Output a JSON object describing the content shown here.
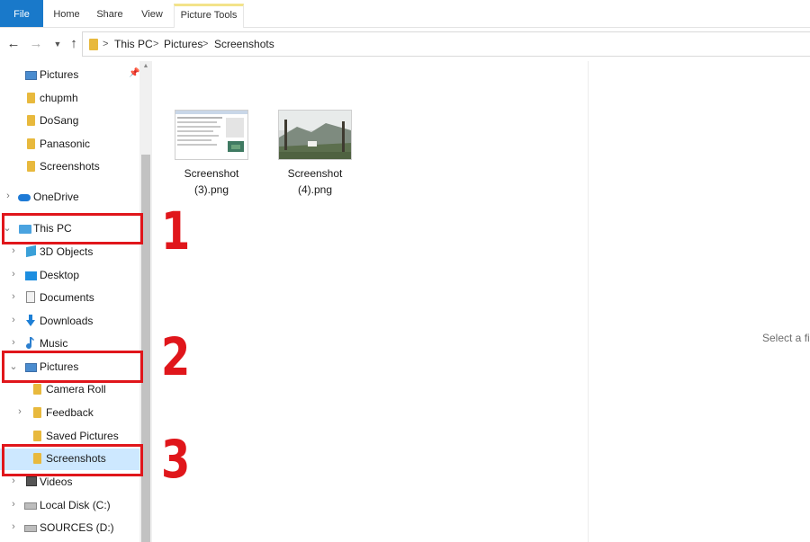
{
  "ribbon": {
    "tabs": [
      "File",
      "Home",
      "Share",
      "View",
      "Picture Tools"
    ]
  },
  "address": {
    "crumbs": [
      "This PC",
      "Pictures",
      "Screenshots"
    ],
    "separator": ">"
  },
  "nav": {
    "quick_access": [
      {
        "label": "Pictures",
        "icon": "pictures-icon",
        "pinned": true
      },
      {
        "label": "chupmh",
        "icon": "folder-icon"
      },
      {
        "label": "DoSang",
        "icon": "folder-icon"
      },
      {
        "label": "Panasonic",
        "icon": "folder-icon"
      },
      {
        "label": "Screenshots",
        "icon": "folder-icon"
      }
    ],
    "onedrive": "OneDrive",
    "this_pc": "This PC",
    "pc_items": [
      "3D Objects",
      "Desktop",
      "Documents",
      "Downloads",
      "Music"
    ],
    "pictures": "Pictures",
    "pictures_children": [
      "Camera Roll",
      "Feedback",
      "Saved Pictures",
      "Screenshots"
    ],
    "after": [
      "Videos",
      "Local Disk (C:)",
      "SOURCES (D:)"
    ]
  },
  "files": [
    {
      "name": "Screenshot (3).png",
      "line1": "Screenshot",
      "line2": "(3).png"
    },
    {
      "name": "Screenshot (4).png",
      "line1": "Screenshot",
      "line2": "(4).png"
    }
  ],
  "preview": {
    "text": "Select a file"
  },
  "annotations": [
    "1",
    "2",
    "3"
  ],
  "colors": {
    "accent": "#1979ca",
    "selection": "#cde8ff",
    "callout": "#e0161b",
    "folder": "#e8b93d"
  }
}
